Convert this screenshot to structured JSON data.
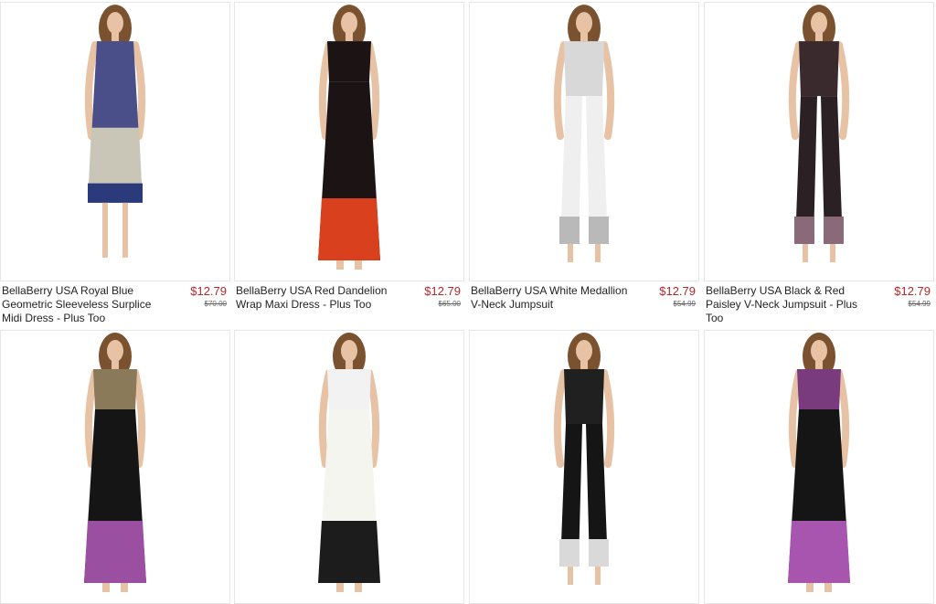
{
  "products": [
    {
      "title": "BellaBerry USA Royal Blue Geometric Sleeveless Surplice Midi Dress - Plus Too",
      "price": "$12.79",
      "original_price": "$70.00",
      "image": "model-midi-dress-icon",
      "colors": {
        "top": "#4a4f8a",
        "mid": "#c9c6b8",
        "hem": "#2b3a7a",
        "skin": "#e7c2a4"
      }
    },
    {
      "title": "BellaBerry USA Red Dandelion Wrap Maxi Dress - Plus Too",
      "price": "$12.79",
      "original_price": "$65.00",
      "image": "model-maxi-dress-icon",
      "colors": {
        "top": "#1c1414",
        "mid": "#1c1414",
        "hem": "#d8401e",
        "skin": "#e7c2a4"
      }
    },
    {
      "title": "BellaBerry USA White Medallion V-Neck Jumpsuit",
      "price": "$12.79",
      "original_price": "$54.99",
      "image": "model-jumpsuit-icon",
      "colors": {
        "top": "#d8d8d8",
        "mid": "#efefef",
        "hem": "#b9b9b9",
        "skin": "#e7c2a4"
      }
    },
    {
      "title": "BellaBerry USA Black & Red Paisley V-Neck Jumpsuit - Plus Too",
      "price": "$12.79",
      "original_price": "$54.99",
      "image": "model-jumpsuit-icon",
      "colors": {
        "top": "#3a2a2e",
        "mid": "#2b2124",
        "hem": "#8a6a78",
        "skin": "#e7c2a4"
      }
    },
    {
      "title": "",
      "price": "",
      "original_price": "",
      "image": "model-off-shoulder-dress-icon",
      "colors": {
        "top": "#8a7a5a",
        "mid": "#151515",
        "hem": "#9b4fa0",
        "skin": "#e7c2a4"
      }
    },
    {
      "title": "",
      "price": "",
      "original_price": "",
      "image": "model-off-shoulder-dress-icon",
      "colors": {
        "top": "#f2f2f2",
        "mid": "#f5f5f0",
        "hem": "#1c1c1c",
        "skin": "#e7c2a4"
      }
    },
    {
      "title": "",
      "price": "",
      "original_price": "",
      "image": "model-off-shoulder-jumpsuit-icon",
      "colors": {
        "top": "#202020",
        "mid": "#151515",
        "hem": "#d9d9d9",
        "skin": "#e7c2a4"
      }
    },
    {
      "title": "",
      "price": "",
      "original_price": "",
      "image": "model-off-shoulder-dress-icon",
      "colors": {
        "top": "#7a3a7e",
        "mid": "#151515",
        "hem": "#a855b0",
        "skin": "#e7c2a4"
      }
    }
  ]
}
